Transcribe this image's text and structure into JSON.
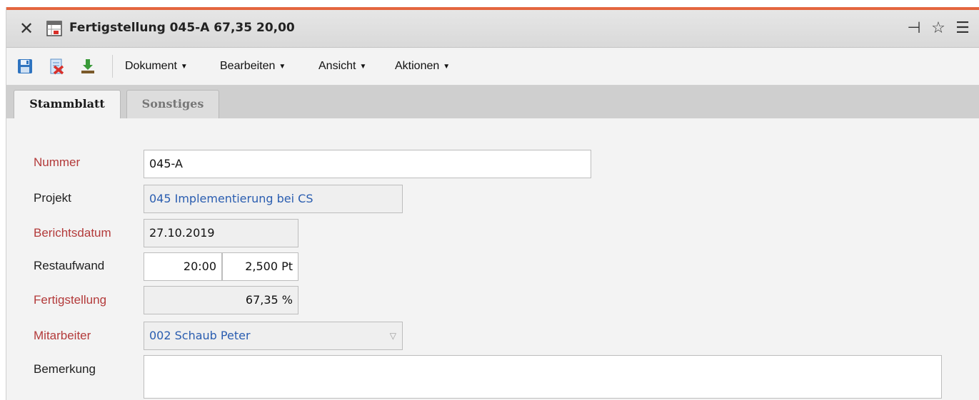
{
  "window": {
    "title": "Fertigstellung 045-A 67,35 20,00",
    "icons": [
      "close-icon",
      "document-icon",
      "pin-icon",
      "star-icon",
      "menu-icon"
    ]
  },
  "toolbar": {
    "icons": [
      "save-icon",
      "discard-icon",
      "download-icon"
    ],
    "menus": [
      {
        "label": "Dokument"
      },
      {
        "label": "Bearbeiten"
      },
      {
        "label": "Ansicht"
      },
      {
        "label": "Aktionen"
      }
    ]
  },
  "tabs": [
    {
      "label": "Stammblatt",
      "active": true
    },
    {
      "label": "Sonstiges",
      "active": false
    }
  ],
  "form": {
    "nummer": {
      "label": "Nummer",
      "value": "045-A"
    },
    "projekt": {
      "label": "Projekt",
      "value": "045 Implementierung bei CS"
    },
    "berichtsdatum": {
      "label": "Berichtsdatum",
      "value": "27.10.2019"
    },
    "restaufwand": {
      "label": "Restaufwand",
      "hours": "20:00",
      "days": "2,500 Pt"
    },
    "fertigstellung": {
      "label": "Fertigstellung",
      "value": "67,35 %"
    },
    "mitarbeiter": {
      "label": "Mitarbeiter",
      "value": "002 Schaub Peter"
    },
    "bemerkung": {
      "label": "Bemerkung",
      "value": ""
    }
  },
  "colors": {
    "accent": "#e4663f",
    "required_label": "#b33a3a",
    "link_value": "#2a5db0"
  }
}
